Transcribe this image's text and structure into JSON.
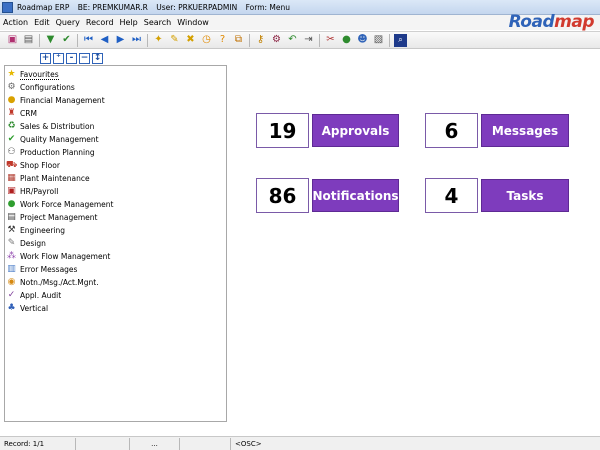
{
  "window": {
    "app_name": "Roadmap ERP",
    "be": "BE: PREMKUMAR.R",
    "user": "User: PRKUERPADMIN",
    "form": "Form: Menu"
  },
  "menu": [
    "Action",
    "Edit",
    "Query",
    "Record",
    "Help",
    "Search",
    "Window"
  ],
  "logo": {
    "part1": "Road",
    "part2": "map"
  },
  "tree": {
    "items": [
      {
        "label": "Favourites",
        "icon": "star-icon",
        "color": "#e6b800",
        "glyph": "★"
      },
      {
        "label": "Configurations",
        "icon": "gear-icon",
        "color": "#666666",
        "glyph": "⚙"
      },
      {
        "label": "Financial Management",
        "icon": "coins-icon",
        "color": "#d9a100",
        "glyph": "●"
      },
      {
        "label": "CRM",
        "icon": "crm-icon",
        "color": "#c0392b",
        "glyph": "♜"
      },
      {
        "label": "Sales & Distribution",
        "icon": "recycle-icon",
        "color": "#2e8b2e",
        "glyph": "♻"
      },
      {
        "label": "Quality Management",
        "icon": "check-badge-icon",
        "color": "#2e9d2e",
        "glyph": "✔"
      },
      {
        "label": "Production Planning",
        "icon": "people-icon",
        "color": "#555555",
        "glyph": "⚇"
      },
      {
        "label": "Shop Floor",
        "icon": "cart-icon",
        "color": "#c0392b",
        "glyph": "⛟"
      },
      {
        "label": "Plant Maintenance",
        "icon": "plant-icon",
        "color": "#b03a2e",
        "glyph": "▦"
      },
      {
        "label": "HR/Payroll",
        "icon": "hr-icon",
        "color": "#b02020",
        "glyph": "▣"
      },
      {
        "label": "Work Force Management",
        "icon": "workforce-icon",
        "color": "#2f9e2f",
        "glyph": "●"
      },
      {
        "label": "Project Management",
        "icon": "project-icon",
        "color": "#444444",
        "glyph": "▤"
      },
      {
        "label": "Engineering",
        "icon": "tools-icon",
        "color": "#333333",
        "glyph": "⚒"
      },
      {
        "label": "Design",
        "icon": "design-icon",
        "color": "#777777",
        "glyph": "✎"
      },
      {
        "label": "Work Flow Management",
        "icon": "workflow-icon",
        "color": "#8e44ad",
        "glyph": "⁂"
      },
      {
        "label": "Error Messages",
        "icon": "error-icon",
        "color": "#4a7cc7",
        "glyph": "▥"
      },
      {
        "label": "Notn./Msg./Act.Mgnt.",
        "icon": "notification-icon",
        "color": "#d68910",
        "glyph": "◉"
      },
      {
        "label": "Appl. Audit",
        "icon": "audit-icon",
        "color": "#7d3c98",
        "glyph": "✓"
      },
      {
        "label": "Vertical",
        "icon": "vertical-icon",
        "color": "#2f5fb8",
        "glyph": "♣"
      }
    ]
  },
  "tiles": [
    {
      "count": "19",
      "label": "Approvals"
    },
    {
      "count": "6",
      "label": "Messages"
    },
    {
      "count": "86",
      "label": "Notifications"
    },
    {
      "count": "4",
      "label": "Tasks"
    }
  ],
  "status": {
    "record": "Record: 1/1",
    "dots": "...",
    "osc": "<OSC>"
  },
  "colors": {
    "accent": "#7e3cbd",
    "brand_blue": "#2f63b8",
    "brand_red": "#d13a2e"
  }
}
